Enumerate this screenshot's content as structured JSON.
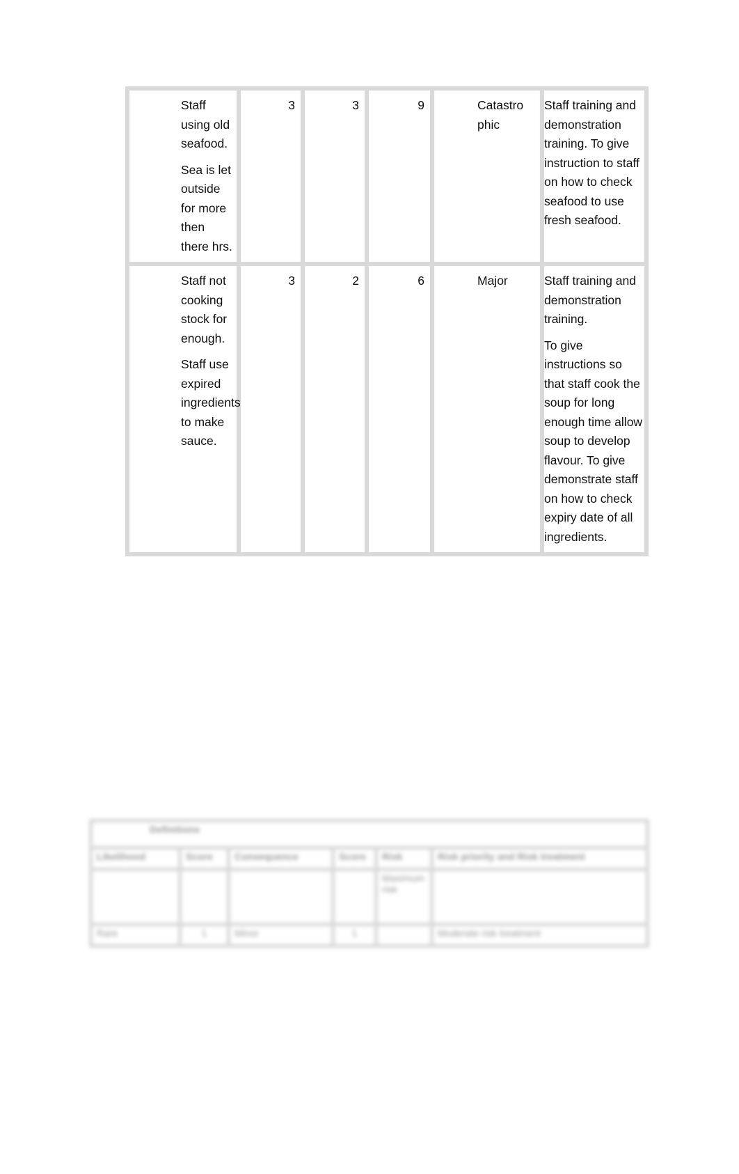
{
  "risk_table": {
    "rows": [
      {
        "hazard": [
          "Staff using old seafood.",
          "Sea is let outside for more then there hrs."
        ],
        "likelihood": "3",
        "consequence": "3",
        "score": "9",
        "severity": "Catastrophic",
        "severity_display": "Catastro phic",
        "controls": [
          "Staff training and demonstration training. To give instruction to staff on how to check seafood to use fresh seafood."
        ]
      },
      {
        "hazard": [
          "Staff not cooking stock for enough.",
          "Staff use expired ingredients to make sauce."
        ],
        "likelihood": "3",
        "consequence": "2",
        "score": "6",
        "severity": "Major",
        "severity_display": "Major",
        "controls": [
          "Staff training and demonstration training.",
          "To give instructions so that staff cook the soup for long enough time allow soup to develop flavour. To give demonstrate staff on how to check expiry date of all ingredients."
        ]
      }
    ]
  },
  "definitions_table": {
    "title": "Definitions",
    "headers": [
      "Likelihood",
      "Score",
      "Consequence",
      "Score",
      "Risk",
      "Risk priority and Risk treatment"
    ],
    "row1": [
      "",
      "",
      "",
      "",
      "Maximum risk",
      ""
    ],
    "row2": [
      "Rare",
      "1",
      "Minor",
      "1",
      "",
      "Moderate risk treatment"
    ],
    "note": "blurred / illegible in screenshot"
  }
}
